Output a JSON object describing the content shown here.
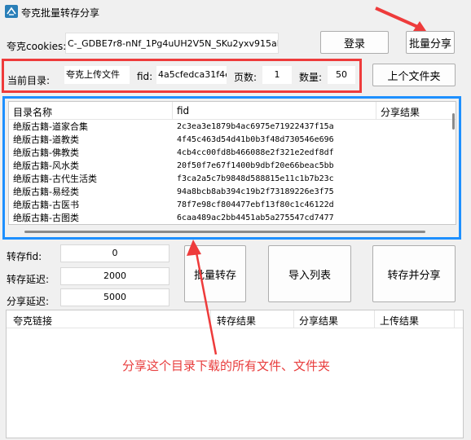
{
  "window": {
    "title": "夸克批量转存分享"
  },
  "top": {
    "cookies_label": "夸克cookies:",
    "cookies_value": "C-_GDBE7r8-nNf_1Pg4uUH2V5N_SKu2yxv915aNi1..",
    "login_button": "登录",
    "batch_share_button": "批量分享"
  },
  "dir": {
    "current_label": "当前目录:",
    "current_value": "夸克上传文件",
    "fid_label": "fid:",
    "fid_value": "4a5cfedca31f4e",
    "page_label": "页数:",
    "page_value": "1",
    "count_label": "数量:",
    "count_value": "50",
    "parent_button": "上个文件夹"
  },
  "file_list": {
    "columns": [
      "目录名称",
      "fid",
      "分享结果"
    ],
    "rows": [
      {
        "name": "绝版古籍-道家合集",
        "fid": "2c3ea3e1879b4ac6975e71922437f15a",
        "result": ""
      },
      {
        "name": "绝版古籍-道教类",
        "fid": "4f45c463d54d41b0b3f48d730546e696",
        "result": ""
      },
      {
        "name": "绝版古籍-佛教类",
        "fid": "4cb4cc00fd8b466088e2f321e2edf8df",
        "result": ""
      },
      {
        "name": "绝版古籍-风水类",
        "fid": "20f50f7e67f1400b9dbf20e66beac5bb",
        "result": ""
      },
      {
        "name": "绝版古籍-古代生活类",
        "fid": "f3ca2a5c7b9848d588815e11c1b7b23c",
        "result": ""
      },
      {
        "name": "绝版古籍-易经类",
        "fid": "94a8bcb8ab394c19b2f73189226e3f75",
        "result": ""
      },
      {
        "name": "绝版古籍-古医书",
        "fid": "78f7e98cf804477ebf13f80c1c46122d",
        "result": ""
      },
      {
        "name": "绝版古籍-古图类",
        "fid": "6caa489ac2bb4451ab5a275547cd7477",
        "result": ""
      }
    ]
  },
  "settings": {
    "save_fid_label": "转存fid:",
    "save_fid_value": "0",
    "save_delay_label": "转存延迟:",
    "save_delay_value": "2000",
    "share_delay_label": "分享延迟:",
    "share_delay_value": "5000"
  },
  "actions": {
    "batch_save": "批量转存",
    "import_list": "导入列表",
    "save_and_share": "转存并分享"
  },
  "link_list": {
    "columns": [
      "夸克链接",
      "转存结果",
      "分享结果",
      "上传结果"
    ]
  },
  "annotation": {
    "text": "分享这个目录下载的所有文件、文件夹",
    "color": "#e83c3c"
  },
  "colors": {
    "highlight_red": "#ee3b3b",
    "highlight_blue": "#1e90ff"
  }
}
